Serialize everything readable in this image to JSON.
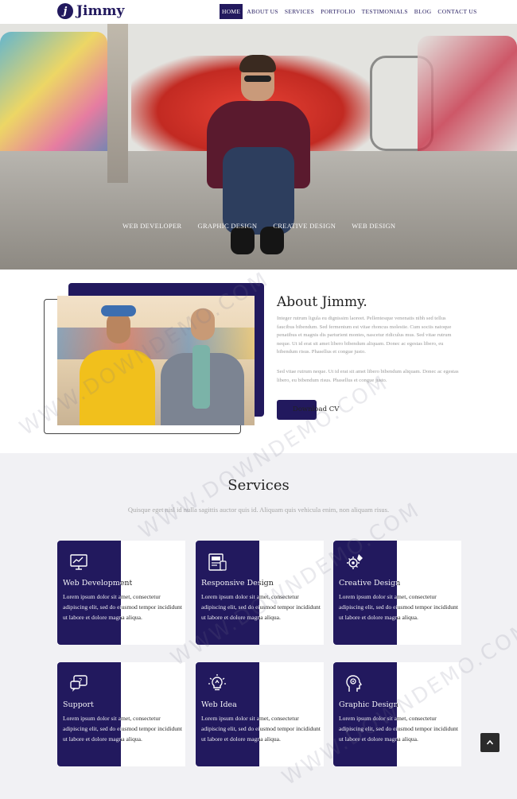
{
  "nav": {
    "logo_mark": "j",
    "logo_text": "Jimmy",
    "items": [
      {
        "label": "HOME",
        "active": true
      },
      {
        "label": "ABOUT US"
      },
      {
        "label": "SERVICES"
      },
      {
        "label": "PORTFOLIO"
      },
      {
        "label": "TESTIMONIALS"
      },
      {
        "label": "BLOG"
      },
      {
        "label": "CONTACT US"
      }
    ]
  },
  "hero": {
    "typed_words": [
      "WEB DEVELOPER",
      "GRAPHIC DESIGN",
      "CREATIVE DESIGN",
      "WEB DESIGN"
    ]
  },
  "about": {
    "title": "About Jimmy.",
    "paragraph1": "Integer rutrum ligula eu dignissim laoreet. Pellentesque venenatis nibh sed tellus faucibus bibendum. Sed fermentum est vitae rhoncus molestie. Cum sociis natoque penatibus et magnis dis parturient montes, nascetur ridiculus mus. Sed vitae rutrum neque. Ut id erat sit amet libero bibendum aliquam. Donec ac egestas libero, eu bibendum risus. Phasellus et congue justo.",
    "paragraph2": "Sed vitae rutrum neque. Ut id erat sit amet libero bibendum aliquam. Donec ac egestas libero, eu bibendum risus. Phasellus et congue justo.",
    "button_label": "Download CV"
  },
  "services": {
    "title": "Services",
    "subtitle": "Quisque eget nisl id nulla sagittis auctor quis id. Aliquam quis vehicula enim, non aliquam risus.",
    "cards": [
      {
        "icon": "monitor-chart-icon",
        "title": "Web Development",
        "body": "Lorem ipsum dolor sit amet, consectetur adipiscing elit, sed do eiusmod tempor incididunt ut labore et dolore magna aliqua."
      },
      {
        "icon": "responsive-layout-icon",
        "title": "Responsive Design",
        "body": "Lorem ipsum dolor sit amet, consectetur adipiscing elit, sed do eiusmod tempor incididunt ut labore et dolore magna aliqua."
      },
      {
        "icon": "gear-pencil-icon",
        "title": "Creative Design",
        "body": "Lorem ipsum dolor sit amet, consectetur adipiscing elit, sed do eiusmod tempor incididunt ut labore et dolore magna aliqua."
      },
      {
        "icon": "chat-question-icon",
        "title": "Support",
        "body": "Lorem ipsum dolor sit amet, consectetur adipiscing elit, sed do eiusmod tempor incididunt ut labore et dolore magna aliqua."
      },
      {
        "icon": "lightbulb-idea-icon",
        "title": "Web Idea",
        "body": "Lorem ipsum dolor sit amet, consectetur adipiscing elit, sed do eiusmod tempor incididunt ut labore et dolore magna aliqua."
      },
      {
        "icon": "head-gears-icon",
        "title": "Graphic Design",
        "body": "Lorem ipsum dolor sit amet, consectetur adipiscing elit, sed do eiusmod tempor incididunt ut labore et dolore magna aliqua."
      }
    ]
  },
  "back_to_top": {
    "icon": "chevron-up-icon"
  },
  "watermark": "WWW.DOWNDEMO.COM",
  "colors": {
    "brand": "#22195e",
    "section_bg": "#f1f1f4",
    "to_top_bg": "#2b2b2b"
  }
}
